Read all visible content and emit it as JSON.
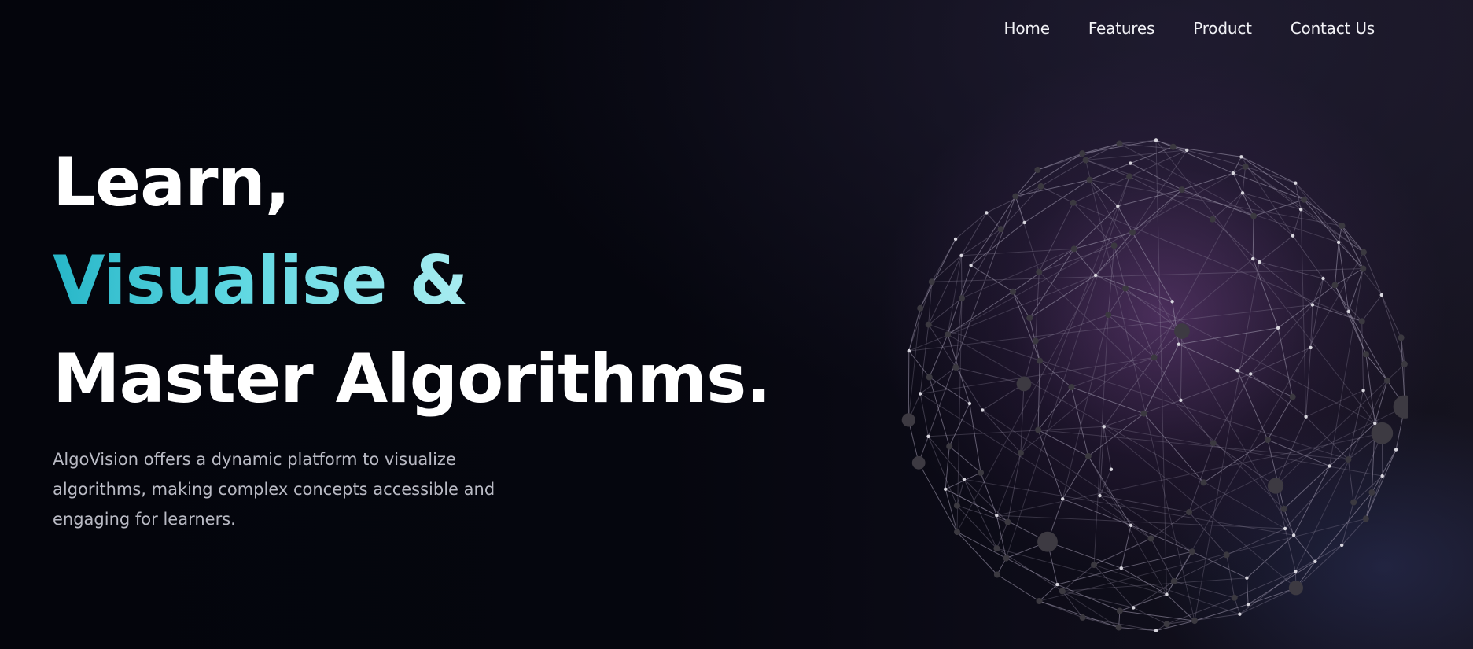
{
  "nav": {
    "items": [
      {
        "id": "home",
        "label": "Home"
      },
      {
        "id": "features",
        "label": "Features"
      },
      {
        "id": "product",
        "label": "Product"
      },
      {
        "id": "contact",
        "label": "Contact Us"
      }
    ]
  },
  "hero": {
    "line1": "Learn,",
    "line2": "Visualise &",
    "line3": "Master Algorithms.",
    "description": "AlgoVision offers a dynamic platform to visualize algorithms, making complex concepts accessible and engaging for learners."
  },
  "colors": {
    "background": "#05060d",
    "accent_start": "#27b6c8",
    "accent_end": "#a9ecf0",
    "glow": "#6a3f80",
    "text": "#ffffff",
    "muted_text": "#b9bac4"
  },
  "graphics": {
    "globe": "network-sphere-graphic"
  }
}
